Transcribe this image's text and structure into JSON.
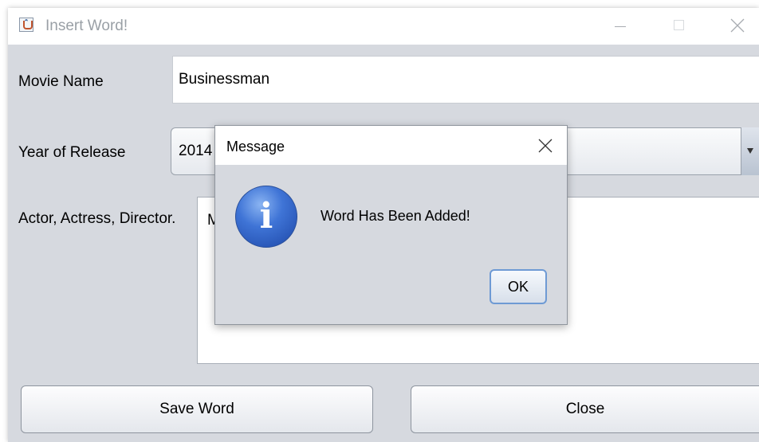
{
  "window": {
    "title": "Insert Word!",
    "controls": {
      "minimize": "minimize-icon",
      "maximize": "maximize-icon",
      "close": "close-icon"
    }
  },
  "form": {
    "movie_name_label": "Movie Name",
    "movie_name_value": "Businessman",
    "year_label": "Year of Release",
    "year_value": "2014",
    "cast_label": "Actor, Actress, Director.",
    "cast_value": "M"
  },
  "buttons": {
    "save_label": "Save Word",
    "close_label": "Close"
  },
  "dialog": {
    "title": "Message",
    "message": "Word Has Been Added!",
    "icon": "info-icon",
    "icon_glyph": "i",
    "ok_label": "OK"
  },
  "colors": {
    "window_bg": "#d6d9df",
    "ok_focus_border": "#6e9ad4",
    "info_icon_blue": "#3f74d6"
  }
}
